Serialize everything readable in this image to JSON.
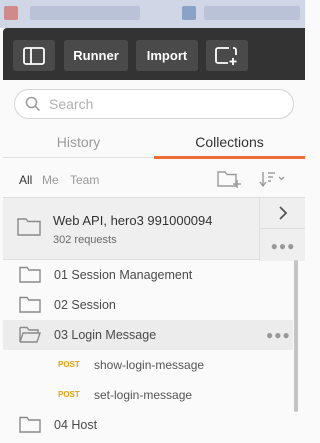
{
  "toolbar": {
    "runner_label": "Runner",
    "import_label": "Import"
  },
  "search": {
    "placeholder": "Search"
  },
  "tabs": {
    "history": "History",
    "collections": "Collections"
  },
  "filters": {
    "all": "All",
    "me": "Me",
    "team": "Team"
  },
  "workspace": {
    "name": "Web API, hero3 991000094",
    "count": "302 requests"
  },
  "folders": [
    {
      "label": "01 Session Management"
    },
    {
      "label": "02 Session"
    },
    {
      "label": "03 Login Message"
    },
    {
      "label": "04 Host"
    }
  ],
  "requests": [
    {
      "method": "POST",
      "name": "show-login-message"
    },
    {
      "method": "POST",
      "name": "set-login-message"
    }
  ],
  "colors": {
    "accent": "#f26b3a",
    "post_method": "#e8a30c",
    "toolbar_bg": "#333333"
  },
  "icons": [
    "sidebar-toggle-icon",
    "new-window-icon",
    "search-icon",
    "new-collection-icon",
    "sort-icon",
    "folder-icon",
    "open-folder-icon",
    "chevron-right-icon",
    "more-dots-icon"
  ]
}
